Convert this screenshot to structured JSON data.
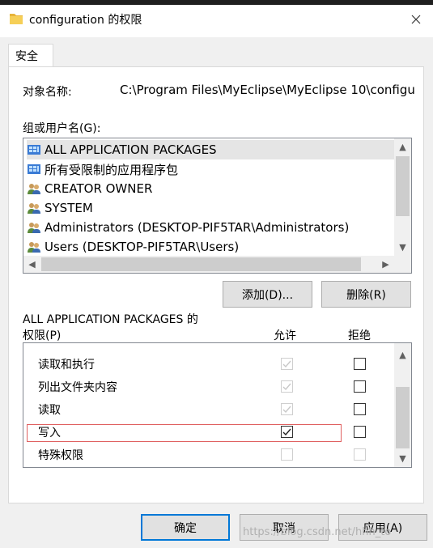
{
  "window": {
    "title": "configuration 的权限"
  },
  "tabs": [
    {
      "label": "安全"
    }
  ],
  "object": {
    "label": "对象名称:",
    "path": "C:\\Program Files\\MyEclipse\\MyEclipse 10\\configu"
  },
  "groups": {
    "label": "组或用户名(G):",
    "items": [
      {
        "label": "ALL APPLICATION PACKAGES",
        "icon": "package-group-icon"
      },
      {
        "label": "所有受限制的应用程序包",
        "icon": "package-group-icon"
      },
      {
        "label": "CREATOR OWNER",
        "icon": "users-group-icon"
      },
      {
        "label": "SYSTEM",
        "icon": "users-group-icon"
      },
      {
        "label": "Administrators (DESKTOP-PIF5TAR\\Administrators)",
        "icon": "users-group-icon"
      },
      {
        "label": "Users (DESKTOP-PIF5TAR\\Users)",
        "icon": "users-group-icon"
      }
    ],
    "add_label": "添加(D)...",
    "remove_label": "删除(R)"
  },
  "permissions": {
    "title_line1": "ALL APPLICATION PACKAGES 的",
    "title_line2": "权限(P)",
    "allow_header": "允许",
    "deny_header": "拒绝",
    "rows": [
      {
        "label": "读取和执行",
        "allow": true,
        "allow_disabled": true,
        "deny": false,
        "deny_disabled": false
      },
      {
        "label": "列出文件夹内容",
        "allow": true,
        "allow_disabled": true,
        "deny": false,
        "deny_disabled": false
      },
      {
        "label": "读取",
        "allow": true,
        "allow_disabled": true,
        "deny": false,
        "deny_disabled": false
      },
      {
        "label": "写入",
        "allow": true,
        "allow_disabled": false,
        "deny": false,
        "deny_disabled": false
      },
      {
        "label": "特殊权限",
        "allow": false,
        "allow_disabled": true,
        "deny": false,
        "deny_disabled": true
      }
    ]
  },
  "footer": {
    "ok_label": "确定",
    "cancel_label": "取消",
    "apply_label": "应用(A)"
  },
  "watermark": "https://blog.csdn.net/hhh_to"
}
